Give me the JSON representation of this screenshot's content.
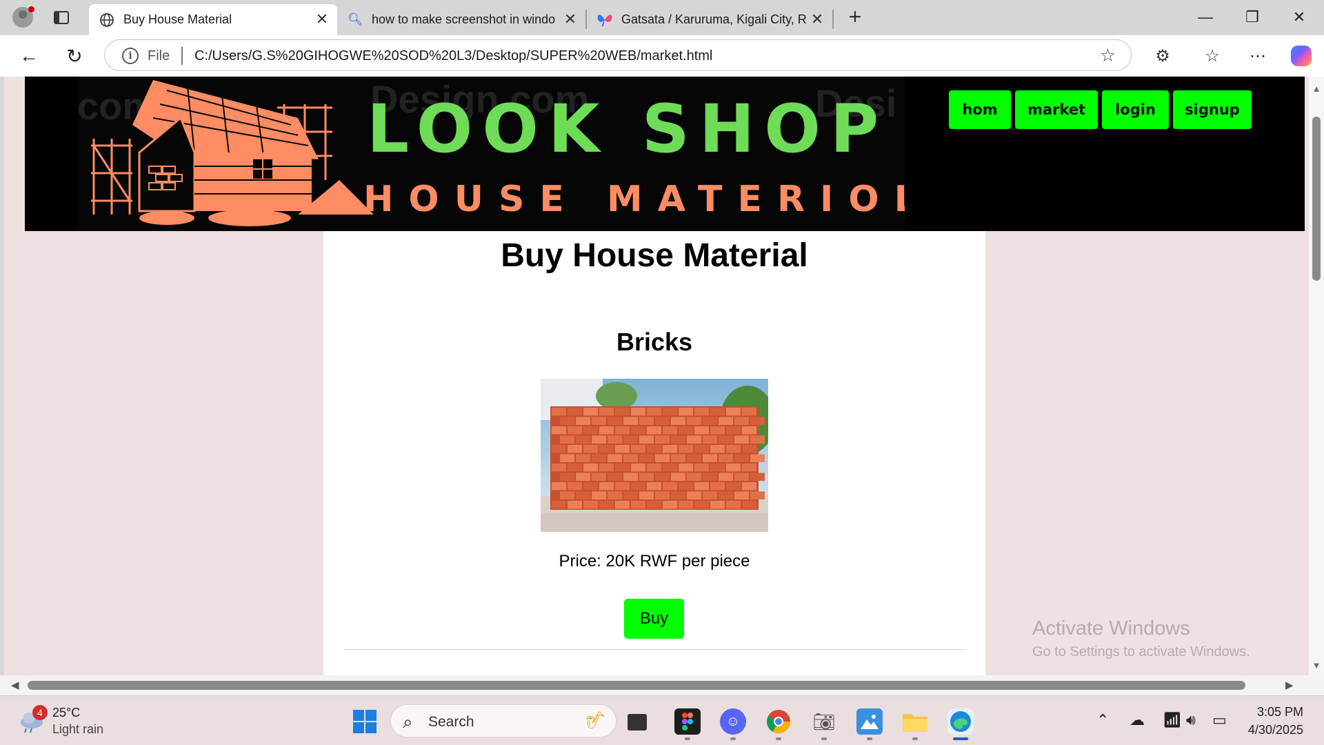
{
  "browser": {
    "tabs": [
      {
        "title": "Buy House Material",
        "icon": "globe-icon",
        "active": true
      },
      {
        "title": "how to make screenshot in windo",
        "icon": "search-icon",
        "active": false
      },
      {
        "title": "Gatsata / Karuruma, Kigali City, Rw",
        "icon": "butterfly-icon",
        "active": false
      }
    ],
    "address": {
      "scheme_label": "File",
      "url": "C:/Users/G.S%20GIHOGWE%20SOD%20L3/Desktop/SUPER%20WEB/market.html"
    }
  },
  "site": {
    "brand_title": "LOOK SHOP",
    "brand_subtitle": "HOUSE MATERIOL",
    "watermarks": [
      "com",
      "Design.com",
      "Desi"
    ],
    "nav": [
      "hom",
      "market",
      "login",
      "signup"
    ],
    "accent_color": "#00ff00",
    "title_color": "#6edc57",
    "subtitle_color": "#ff8c63"
  },
  "page": {
    "heading": "Buy House Material",
    "product": {
      "name": "Bricks",
      "price_text": "Price: 20K RWF per piece",
      "buy_label": "Buy"
    }
  },
  "watermark_windows": {
    "line1": "Activate Windows",
    "line2": "Go to Settings to activate Windows."
  },
  "taskbar": {
    "weather": {
      "badge": "4",
      "temp": "25°C",
      "desc": "Light rain"
    },
    "search_placeholder": "Search",
    "clock": {
      "time": "3:05 PM",
      "date": "4/30/2025"
    }
  }
}
